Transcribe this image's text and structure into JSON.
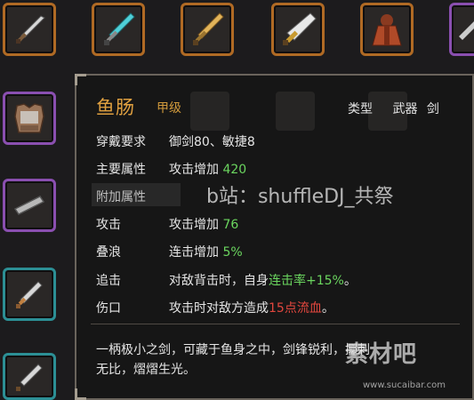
{
  "item": {
    "name": "鱼肠",
    "grade": "甲级",
    "type_label": "类型",
    "type_value": "武器",
    "subtype": "剑"
  },
  "stats": [
    {
      "label": "穿戴要求",
      "value": "御剑80、敏捷8"
    },
    {
      "label": "主要属性",
      "value": "攻击增加",
      "num": "420"
    },
    {
      "label": "附加属性",
      "value": ""
    },
    {
      "label": "攻击",
      "value": "攻击增加",
      "num": "76"
    },
    {
      "label": "叠浪",
      "value": "连击增加",
      "num": "5%"
    },
    {
      "label": "追击",
      "value": "对敌背击时，自身",
      "hl": "连击率+15%",
      "tail": "。"
    },
    {
      "label": "伤口",
      "value": "攻击时对敌方造成",
      "hl": "15点流血",
      "tail": "。"
    }
  ],
  "description": "一柄极小之剑，可藏于鱼身之中，剑锋锐利，揶刺无比，熠熠生光。",
  "watermark": "b站：shuffleDJ_共祭",
  "site_logo": "素材吧",
  "site_url": "www.sucaibar.com",
  "colors": {
    "title": "#e0a040",
    "green": "#6bd65f",
    "red": "#e2473e"
  }
}
